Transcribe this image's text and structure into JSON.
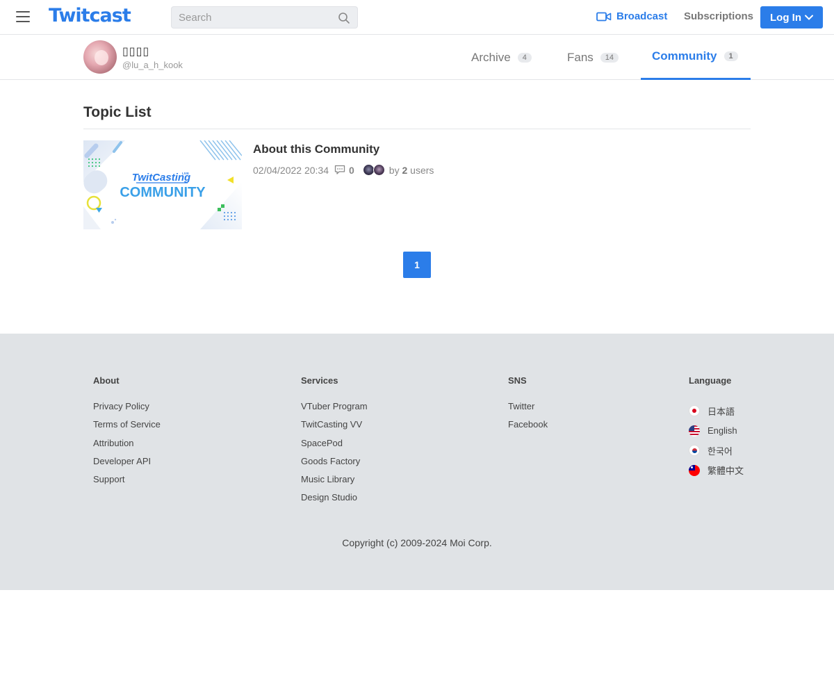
{
  "header": {
    "logo": "Twitcast",
    "search_placeholder": "Search",
    "broadcast_label": "Broadcast",
    "subscriptions_label": "Subscriptions",
    "login_label": "Log In",
    "accent_color": "#2b7de9"
  },
  "profile": {
    "name": "▯▯▯▯",
    "handle": "@lu_a_h_kook",
    "tabs": [
      {
        "label": "Archive",
        "count": "4"
      },
      {
        "label": "Fans",
        "count": "14"
      },
      {
        "label": "Community",
        "count": "1",
        "active": true
      }
    ]
  },
  "main": {
    "section_title": "Topic List",
    "topics": [
      {
        "title": "About this Community",
        "thumbnail_brand": "TwitCasting",
        "thumbnail_tag": "LIVE",
        "thumbnail_word": "COMMUNITY",
        "date": "02/04/2022 20:34",
        "comments": "0",
        "by_prefix": "by",
        "user_count": "2",
        "users_suffix": "users"
      }
    ],
    "pagination": [
      "1"
    ]
  },
  "footer": {
    "about": {
      "heading": "About",
      "links": [
        "Privacy Policy",
        "Terms of Service",
        "Attribution",
        "Developer API",
        "Support"
      ]
    },
    "services": {
      "heading": "Services",
      "links": [
        "VTuber Program",
        "TwitCasting VV",
        "SpacePod",
        "Goods Factory",
        "Music Library",
        "Design Studio"
      ]
    },
    "sns": {
      "heading": "SNS",
      "links": [
        "Twitter",
        "Facebook"
      ]
    },
    "language": {
      "heading": "Language",
      "items": [
        {
          "label": "日本語",
          "flag": "japan-flag-icon"
        },
        {
          "label": "English",
          "flag": "usa-flag-icon"
        },
        {
          "label": "한국어",
          "flag": "korea-flag-icon"
        },
        {
          "label": "繁體中文",
          "flag": "taiwan-flag-icon"
        }
      ]
    },
    "copyright": "Copyright (c) 2009-2024 Moi Corp."
  }
}
